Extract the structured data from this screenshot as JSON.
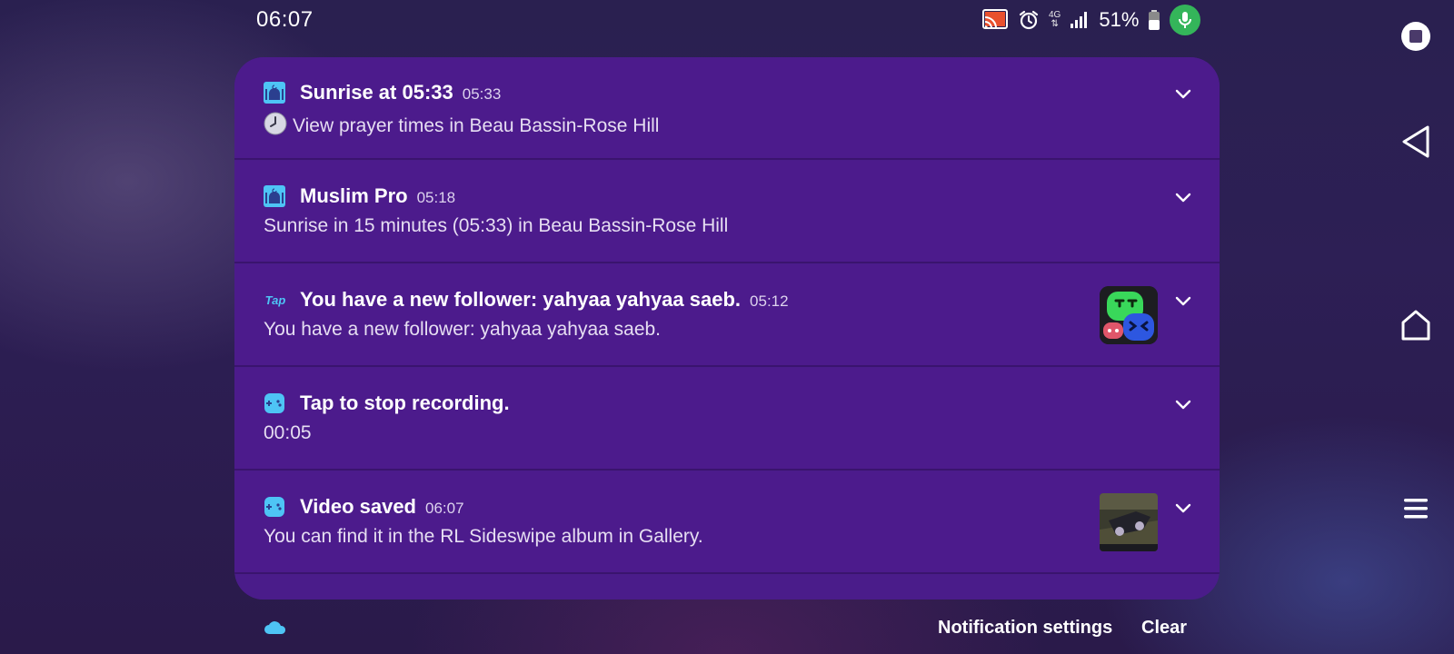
{
  "status_bar": {
    "time": "06:07",
    "network_type": "4G",
    "battery_percent": "51%",
    "icons": [
      "cast-icon",
      "alarm-icon",
      "network-4g-icon",
      "signal-icon",
      "battery-icon",
      "mic-active-icon"
    ],
    "mic_color": "#34b55a"
  },
  "notifications": [
    {
      "app": "muslim-pro",
      "icon": "mosque-icon",
      "title": "Sunrise at 05:33",
      "time": "05:33",
      "body": "View prayer times in Beau Bassin-Rose Hill",
      "body_icon": "clock-emoji-icon"
    },
    {
      "app": "muslim-pro",
      "icon": "mosque-icon",
      "title": "Muslim Pro",
      "time": "05:18",
      "body": "Sunrise in 15 minutes (05:33) in Beau Bassin-Rose Hill"
    },
    {
      "app": "taptap",
      "icon": "tap-logo-icon",
      "icon_text": "Tap",
      "title": "You have a new follower: yahyaa yahyaa saeb.",
      "time": "05:12",
      "body": "You have a new follower: yahyaa yahyaa saeb.",
      "thumbnail": "game-characters-thumbnail"
    },
    {
      "app": "game-recorder",
      "icon": "game-controller-icon",
      "title": "Tap to stop recording.",
      "time": "",
      "body": "00:05"
    },
    {
      "app": "game-recorder",
      "icon": "game-controller-icon",
      "title": "Video saved",
      "time": "06:07",
      "body": "You can find it in the RL Sideswipe album in Gallery.",
      "thumbnail": "video-thumbnail"
    }
  ],
  "footer": {
    "cloud_icon": "cloud-icon",
    "settings_label": "Notification settings",
    "clear_label": "Clear"
  },
  "nav_bar": {
    "buttons": [
      "recent-apps-button",
      "back-button",
      "home-button",
      "menu-button"
    ]
  },
  "colors": {
    "panel": "#4a1c8a",
    "card": "#4c1b8c",
    "accent_cyan": "#4ec4f5"
  }
}
